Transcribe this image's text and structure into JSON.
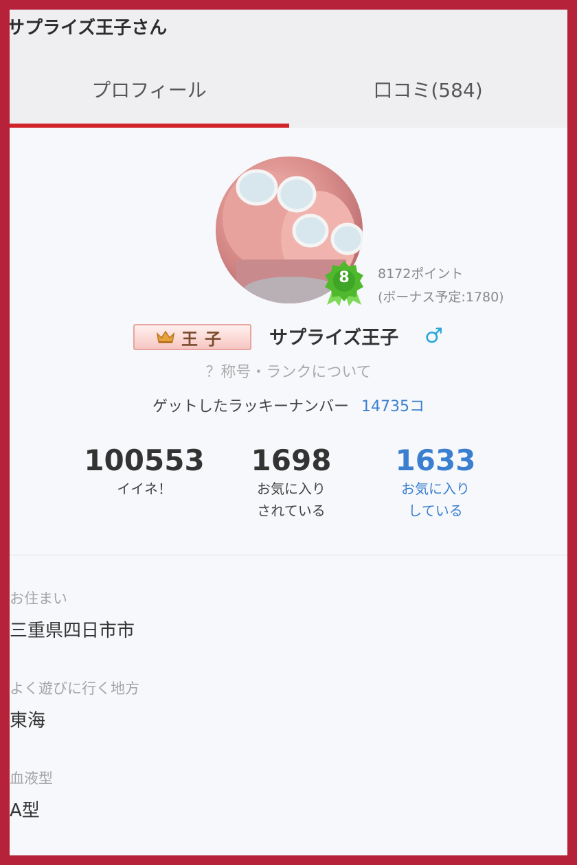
{
  "app": {
    "title": "サプライズ王子さん"
  },
  "tabs": [
    {
      "label": "プロフィール",
      "active": true
    },
    {
      "label": "口コミ(584)",
      "active": false
    }
  ],
  "profile": {
    "rank_level": "8",
    "points": "8172ポイント",
    "bonus": "(ボーナス予定:1780)",
    "title_badge": "王子",
    "name": "サプライズ王子",
    "gender_symbol": "♂",
    "rank_link": "？称号・ランクについて",
    "lucky_label": "ゲットしたラッキーナンバー",
    "lucky_value": "14735コ"
  },
  "stats": [
    {
      "value": "100553",
      "label_1": "イイネ！",
      "label_2": ""
    },
    {
      "value": "1698",
      "label_1": "お気に入り",
      "label_2": "されている"
    },
    {
      "value": "1633",
      "label_1": "お気に入り",
      "label_2": "している"
    }
  ],
  "details": [
    {
      "label": "お住まい",
      "value": "三重県四日市市"
    },
    {
      "label": "よく遊びに行く地方",
      "value": "東海"
    },
    {
      "label": "血液型",
      "value": "A型"
    }
  ],
  "colors": {
    "frame": "#b5223a",
    "tab_underline": "#d1232a",
    "accent_blue": "#3a7fd0",
    "male_icon": "#27a6d8",
    "rank_badge": "#4fb82d"
  },
  "icons": [
    "crown-icon",
    "male-icon",
    "rank-badge-icon"
  ]
}
